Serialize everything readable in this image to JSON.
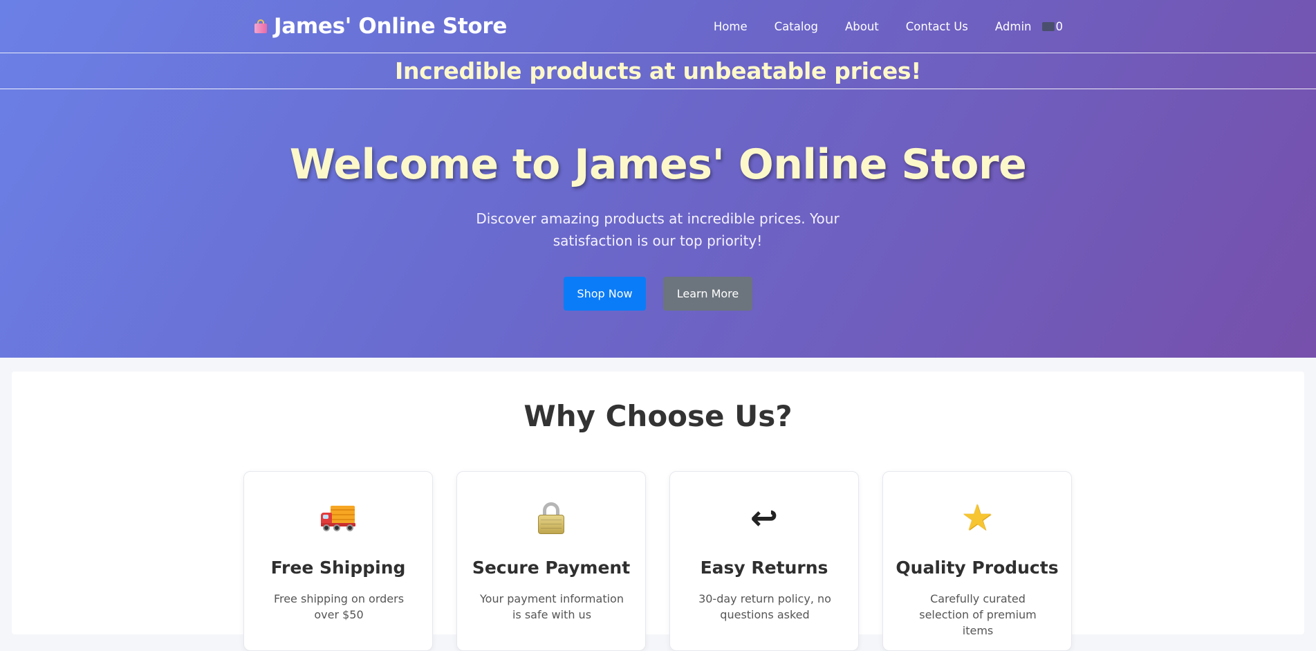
{
  "header": {
    "store_name": "James' Online Store",
    "nav": [
      "Home",
      "Catalog",
      "About",
      "Contact Us",
      "Admin"
    ],
    "cart_count": "0"
  },
  "banner": {
    "text": "Incredible products at unbeatable prices!"
  },
  "hero": {
    "title": "Welcome to James' Online Store",
    "subtitle": "Discover amazing products at incredible prices. Your satisfaction is our top priority!",
    "primary_button": "Shop Now",
    "secondary_button": "Learn More"
  },
  "features": {
    "title": "Why Choose Us?",
    "cards": [
      {
        "icon": "truck-icon",
        "title": "Free Shipping",
        "text": "Free shipping on orders over $50"
      },
      {
        "icon": "lock-icon",
        "title": "Secure Payment",
        "text": "Your payment information is safe with us"
      },
      {
        "icon": "return-arrow-icon",
        "title": "Easy Returns",
        "text": "30-day return policy, no questions asked"
      },
      {
        "icon": "star-icon",
        "title": "Quality Products",
        "text": "Carefully curated selection of premium items"
      }
    ]
  },
  "colors": {
    "gradient_start": "#6b80e6",
    "gradient_end": "#7650ab",
    "accent_text": "#fdf8c9",
    "primary_button": "#0b7cf7",
    "secondary_button": "#6c757d"
  }
}
